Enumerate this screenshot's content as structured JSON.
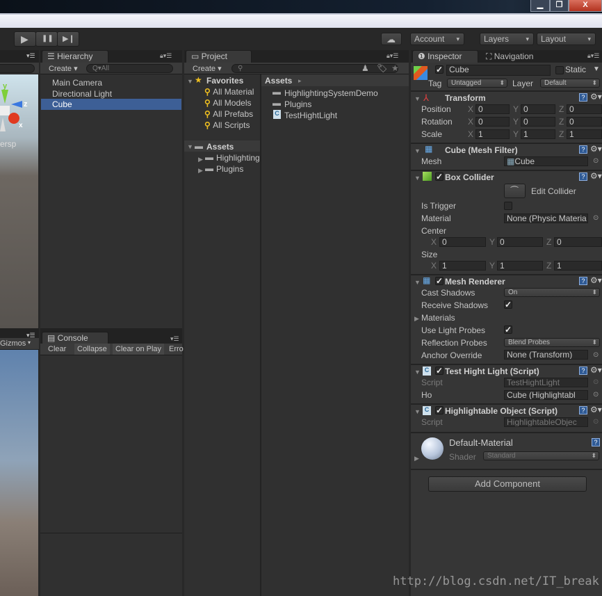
{
  "window": {
    "minimize": "▁",
    "restore": "❐",
    "close": "X"
  },
  "toolbar": {
    "play": "▶",
    "pause": "❚❚",
    "step": "▶❙",
    "cloud": "☁",
    "account": "Account",
    "layers": "Layers",
    "layout": "Layout",
    "arrow": "▾"
  },
  "scene": {
    "persp": "ersp",
    "axis_y": "y",
    "axis_z": "z",
    "axis_x": "x",
    "gizmos": "Gizmos"
  },
  "hierarchy": {
    "tab": "Hierarchy",
    "create": "Create",
    "search_placeholder": "Q▾All",
    "items": [
      "Main Camera",
      "Directional Light",
      "Cube"
    ],
    "selected": "Cube"
  },
  "project": {
    "tab": "Project",
    "create": "Create",
    "favorites": {
      "label": "Favorites",
      "items": [
        "All Material",
        "All Models",
        "All Prefabs",
        "All Scripts"
      ]
    },
    "assets": {
      "label": "Assets",
      "items": [
        "Highlighting",
        "Plugins"
      ]
    },
    "breadcrumb": "Assets",
    "files": [
      "HighlightingSystemDemo",
      "Plugins",
      "TestHightLight"
    ]
  },
  "console": {
    "tab": "Console",
    "clear": "Clear",
    "collapse": "Collapse",
    "clear_on_play": "Clear on Play",
    "error_pause": "Erro"
  },
  "inspector": {
    "tab": "Inspector",
    "nav_tab": "Navigation",
    "object": {
      "name": "Cube",
      "active": true,
      "static_label": "Static",
      "tag_label": "Tag",
      "tag": "Untagged",
      "layer_label": "Layer",
      "layer": "Default"
    },
    "transform": {
      "title": "Transform",
      "rows": [
        {
          "label": "Position",
          "x": "0",
          "y": "0",
          "z": "0"
        },
        {
          "label": "Rotation",
          "x": "0",
          "y": "0",
          "z": "0"
        },
        {
          "label": "Scale",
          "x": "1",
          "y": "1",
          "z": "1"
        }
      ]
    },
    "mesh_filter": {
      "title": "Cube (Mesh Filter)",
      "mesh_label": "Mesh",
      "mesh": "Cube"
    },
    "box_collider": {
      "title": "Box Collider",
      "edit": "Edit Collider",
      "is_trigger": "Is Trigger",
      "material_label": "Material",
      "material": "None (Physic Materia",
      "center": "Center",
      "center_xyz": [
        "0",
        "0",
        "0"
      ],
      "size": "Size",
      "size_xyz": [
        "1",
        "1",
        "1"
      ]
    },
    "mesh_renderer": {
      "title": "Mesh Renderer",
      "cast_shadows": "Cast Shadows",
      "cast_value": "On",
      "receive_shadows": "Receive Shadows",
      "materials": "Materials",
      "use_light_probes": "Use Light Probes",
      "reflection_probes": "Reflection Probes",
      "reflection_value": "Blend Probes",
      "anchor_override": "Anchor Override",
      "anchor_value": "None (Transform)"
    },
    "test_script": {
      "title": "Test Hight Light (Script)",
      "script_label": "Script",
      "script": "TestHightLight",
      "ho_label": "Ho",
      "ho": "Cube (Highlightabl"
    },
    "highlightable": {
      "title": "Highlightable Object (Script)",
      "script_label": "Script",
      "script": "HighlightableObjec"
    },
    "material": {
      "name": "Default-Material",
      "shader_label": "Shader",
      "shader": "Standard"
    },
    "add_component": "Add Component"
  },
  "watermark": "http://blog.csdn.net/IT_break"
}
